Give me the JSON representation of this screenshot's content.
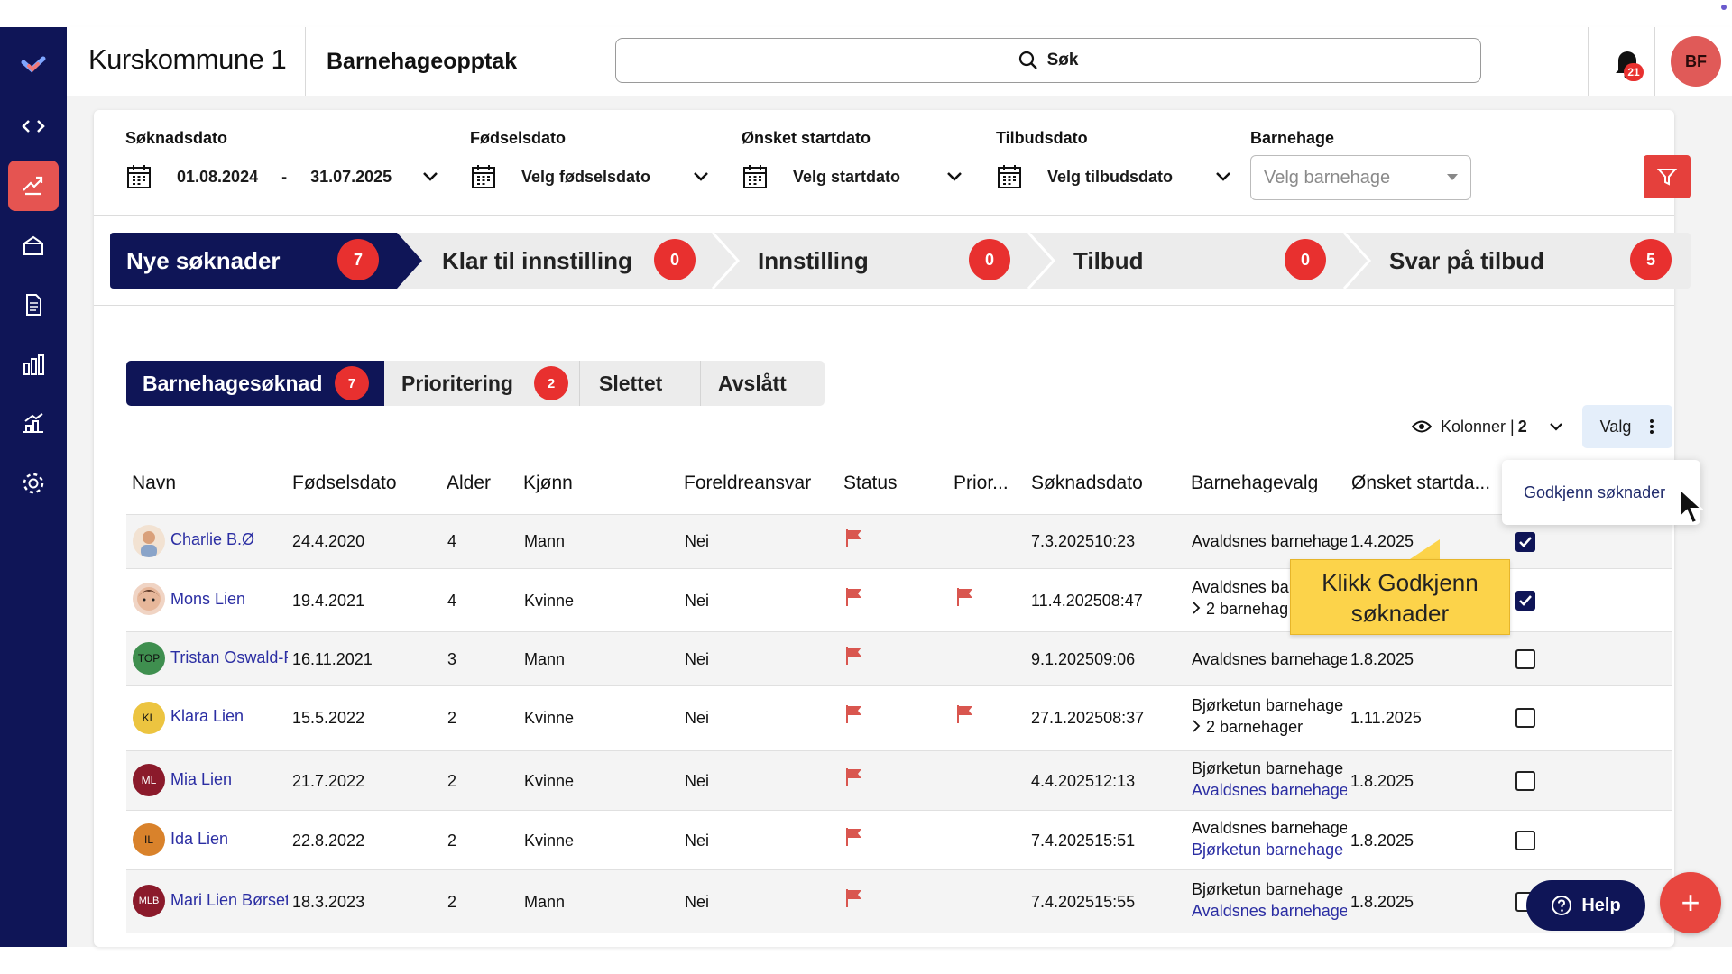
{
  "header": {
    "app_title": "Kurskommune 1",
    "module_title": "Barnehageopptak",
    "search_label": "Søk",
    "notification_count": "21",
    "user_initials": "BF"
  },
  "filters": {
    "soknadsdato": {
      "label": "Søknadsdato",
      "from": "01.08.2024",
      "sep": "-",
      "to": "31.07.2025"
    },
    "fodselsdato": {
      "label": "Fødselsdato",
      "value": "Velg fødselsdato"
    },
    "onsket": {
      "label": "Ønsket startdato",
      "value": "Velg startdato"
    },
    "tilbud": {
      "label": "Tilbudsdato",
      "value": "Velg tilbudsdato"
    },
    "barnehage": {
      "label": "Barnehage",
      "placeholder": "Velg barnehage"
    }
  },
  "steps": [
    {
      "label": "Nye søknader",
      "count": "7"
    },
    {
      "label": "Klar til innstilling",
      "count": "0"
    },
    {
      "label": "Innstilling",
      "count": "0"
    },
    {
      "label": "Tilbud",
      "count": "0"
    },
    {
      "label": "Svar på tilbud",
      "count": "5"
    }
  ],
  "tabs": [
    {
      "label": "Barnehagesøknad",
      "count": "7"
    },
    {
      "label": "Prioritering",
      "count": "2"
    },
    {
      "label": "Slettet"
    },
    {
      "label": "Avslått"
    }
  ],
  "toolbar": {
    "kolonner_label": "Kolonner |",
    "kolonner_count": "2",
    "valg_label": "Valg"
  },
  "columns": [
    "Navn",
    "Fødselsdato",
    "Alder",
    "Kjønn",
    "Foreldreansvar",
    "Status",
    "Prior...",
    "Søknadsdato",
    "Barnehagevalg",
    "Ønsket startda..."
  ],
  "rows": [
    {
      "initials": "",
      "name": "Charlie B.Ø",
      "dob": "24.4.2020",
      "age": "4",
      "gender": "Mann",
      "custody": "Nei",
      "date": "7.3.202510:23",
      "choice1": "Avaldsnes barnehage (",
      "choice2": "",
      "start": "1.4.2025",
      "checked": true,
      "prio": false
    },
    {
      "initials": "",
      "name": "Mons Lien",
      "dob": "19.4.2021",
      "age": "4",
      "gender": "Kvinne",
      "custody": "Nei",
      "date": "11.4.202508:47",
      "choice1": "Avaldsnes barn",
      "choice2": "2 barnehag",
      "start": "",
      "checked": true,
      "prio": true
    },
    {
      "initials": "TOP",
      "name": "Tristan Oswald-P",
      "dob": "16.11.2021",
      "age": "3",
      "gender": "Mann",
      "custody": "Nei",
      "date": "9.1.202509:06",
      "choice1": "Avaldsnes barnehage (",
      "choice2": "",
      "start": "1.8.2025",
      "checked": false,
      "prio": false
    },
    {
      "initials": "KL",
      "name": "Klara Lien",
      "dob": "15.5.2022",
      "age": "2",
      "gender": "Kvinne",
      "custody": "Nei",
      "date": "27.1.202508:37",
      "choice1": "Bjørketun barnehage ('",
      "choice2": "2 barnehager",
      "start": "1.11.2025",
      "checked": false,
      "prio": true
    },
    {
      "initials": "ML",
      "name": "Mia Lien",
      "dob": "21.7.2022",
      "age": "2",
      "gender": "Kvinne",
      "custody": "Nei",
      "date": "4.4.202512:13",
      "choice1": "Bjørketun barnehage ('",
      "choice2": "Avaldsnes barnehage -",
      "start": "1.8.2025",
      "checked": false,
      "prio": false
    },
    {
      "initials": "IL",
      "name": "Ida Lien",
      "dob": "22.8.2022",
      "age": "2",
      "gender": "Kvinne",
      "custody": "Nei",
      "date": "7.4.202515:51",
      "choice1": "Avaldsnes barnehage (",
      "choice2": "Bjørketun barnehage -",
      "start": "1.8.2025",
      "checked": false,
      "prio": false
    },
    {
      "initials": "MLB",
      "name": "Mari Lien Børseth",
      "dob": "18.3.2023",
      "age": "2",
      "gender": "Mann",
      "custody": "Nei",
      "date": "7.4.202515:55",
      "choice1": "Bjørketun barnehage ('",
      "choice2": "Avaldsnes barnehage -",
      "start": "1.8.2025",
      "checked": false,
      "prio": false
    }
  ],
  "menu": {
    "item": "Godkjenn søknader"
  },
  "tooltip": {
    "line1": "Klikk Godkjenn",
    "line2": "søknader"
  },
  "help_label": "Help",
  "fab_label": "+",
  "colors": {
    "navy": "#0f1557",
    "accent_red": "#e8302f",
    "tooltip_yellow": "#fcd34a",
    "link_blue": "#2b2ea3"
  }
}
